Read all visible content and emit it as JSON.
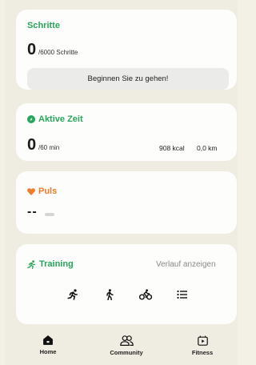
{
  "colors": {
    "green": "#27a55a",
    "orange": "#f07b2c",
    "background": "#efece2",
    "card": "#fdfdfb"
  },
  "steps": {
    "title": "Schritte",
    "value": "0",
    "goal": "/6000 Schritte",
    "button_label": "Beginnen Sie zu gehen!"
  },
  "active": {
    "title": "Aktive Zeit",
    "value": "0",
    "goal": "/60 min",
    "kcal": "908 kcal",
    "km": "0,0 km"
  },
  "pulse": {
    "title": "Puls",
    "value": "--"
  },
  "training": {
    "title": "Training",
    "history_link": "Verlauf anzeigen",
    "activities": [
      "running-icon",
      "walking-icon",
      "cycling-icon",
      "list-icon"
    ]
  },
  "nav": {
    "items": [
      {
        "label": "Home",
        "icon": "home-icon"
      },
      {
        "label": "Community",
        "icon": "community-icon"
      },
      {
        "label": "Fitness",
        "icon": "fitness-icon"
      }
    ]
  }
}
